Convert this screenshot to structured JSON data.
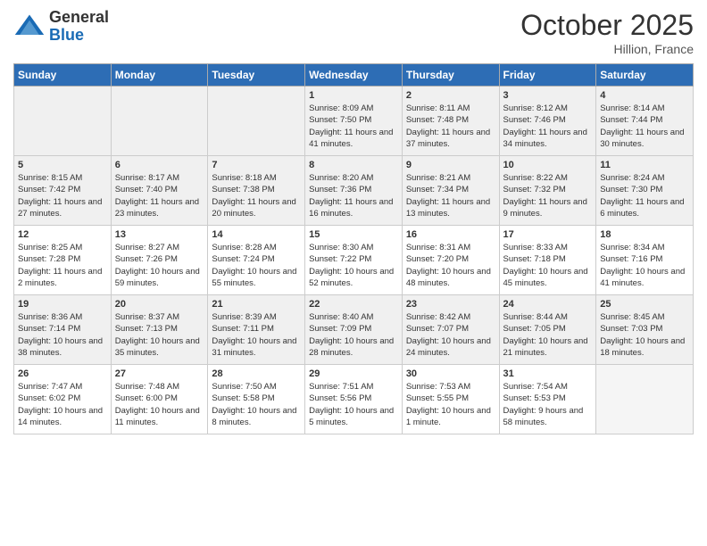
{
  "logo": {
    "general": "General",
    "blue": "Blue"
  },
  "header": {
    "title": "October 2025",
    "location": "Hillion, France"
  },
  "days": [
    "Sunday",
    "Monday",
    "Tuesday",
    "Wednesday",
    "Thursday",
    "Friday",
    "Saturday"
  ],
  "weeks": [
    [
      {
        "day": "",
        "sunrise": "",
        "sunset": "",
        "daylight": "",
        "shaded": true
      },
      {
        "day": "",
        "sunrise": "",
        "sunset": "",
        "daylight": "",
        "shaded": true
      },
      {
        "day": "",
        "sunrise": "",
        "sunset": "",
        "daylight": "",
        "shaded": true
      },
      {
        "day": "1",
        "sunrise": "Sunrise: 8:09 AM",
        "sunset": "Sunset: 7:50 PM",
        "daylight": "Daylight: 11 hours and 41 minutes.",
        "shaded": false
      },
      {
        "day": "2",
        "sunrise": "Sunrise: 8:11 AM",
        "sunset": "Sunset: 7:48 PM",
        "daylight": "Daylight: 11 hours and 37 minutes.",
        "shaded": false
      },
      {
        "day": "3",
        "sunrise": "Sunrise: 8:12 AM",
        "sunset": "Sunset: 7:46 PM",
        "daylight": "Daylight: 11 hours and 34 minutes.",
        "shaded": false
      },
      {
        "day": "4",
        "sunrise": "Sunrise: 8:14 AM",
        "sunset": "Sunset: 7:44 PM",
        "daylight": "Daylight: 11 hours and 30 minutes.",
        "shaded": false
      }
    ],
    [
      {
        "day": "5",
        "sunrise": "Sunrise: 8:15 AM",
        "sunset": "Sunset: 7:42 PM",
        "daylight": "Daylight: 11 hours and 27 minutes.",
        "shaded": true
      },
      {
        "day": "6",
        "sunrise": "Sunrise: 8:17 AM",
        "sunset": "Sunset: 7:40 PM",
        "daylight": "Daylight: 11 hours and 23 minutes.",
        "shaded": true
      },
      {
        "day": "7",
        "sunrise": "Sunrise: 8:18 AM",
        "sunset": "Sunset: 7:38 PM",
        "daylight": "Daylight: 11 hours and 20 minutes.",
        "shaded": true
      },
      {
        "day": "8",
        "sunrise": "Sunrise: 8:20 AM",
        "sunset": "Sunset: 7:36 PM",
        "daylight": "Daylight: 11 hours and 16 minutes.",
        "shaded": true
      },
      {
        "day": "9",
        "sunrise": "Sunrise: 8:21 AM",
        "sunset": "Sunset: 7:34 PM",
        "daylight": "Daylight: 11 hours and 13 minutes.",
        "shaded": true
      },
      {
        "day": "10",
        "sunrise": "Sunrise: 8:22 AM",
        "sunset": "Sunset: 7:32 PM",
        "daylight": "Daylight: 11 hours and 9 minutes.",
        "shaded": true
      },
      {
        "day": "11",
        "sunrise": "Sunrise: 8:24 AM",
        "sunset": "Sunset: 7:30 PM",
        "daylight": "Daylight: 11 hours and 6 minutes.",
        "shaded": true
      }
    ],
    [
      {
        "day": "12",
        "sunrise": "Sunrise: 8:25 AM",
        "sunset": "Sunset: 7:28 PM",
        "daylight": "Daylight: 11 hours and 2 minutes.",
        "shaded": false
      },
      {
        "day": "13",
        "sunrise": "Sunrise: 8:27 AM",
        "sunset": "Sunset: 7:26 PM",
        "daylight": "Daylight: 10 hours and 59 minutes.",
        "shaded": false
      },
      {
        "day": "14",
        "sunrise": "Sunrise: 8:28 AM",
        "sunset": "Sunset: 7:24 PM",
        "daylight": "Daylight: 10 hours and 55 minutes.",
        "shaded": false
      },
      {
        "day": "15",
        "sunrise": "Sunrise: 8:30 AM",
        "sunset": "Sunset: 7:22 PM",
        "daylight": "Daylight: 10 hours and 52 minutes.",
        "shaded": false
      },
      {
        "day": "16",
        "sunrise": "Sunrise: 8:31 AM",
        "sunset": "Sunset: 7:20 PM",
        "daylight": "Daylight: 10 hours and 48 minutes.",
        "shaded": false
      },
      {
        "day": "17",
        "sunrise": "Sunrise: 8:33 AM",
        "sunset": "Sunset: 7:18 PM",
        "daylight": "Daylight: 10 hours and 45 minutes.",
        "shaded": false
      },
      {
        "day": "18",
        "sunrise": "Sunrise: 8:34 AM",
        "sunset": "Sunset: 7:16 PM",
        "daylight": "Daylight: 10 hours and 41 minutes.",
        "shaded": false
      }
    ],
    [
      {
        "day": "19",
        "sunrise": "Sunrise: 8:36 AM",
        "sunset": "Sunset: 7:14 PM",
        "daylight": "Daylight: 10 hours and 38 minutes.",
        "shaded": true
      },
      {
        "day": "20",
        "sunrise": "Sunrise: 8:37 AM",
        "sunset": "Sunset: 7:13 PM",
        "daylight": "Daylight: 10 hours and 35 minutes.",
        "shaded": true
      },
      {
        "day": "21",
        "sunrise": "Sunrise: 8:39 AM",
        "sunset": "Sunset: 7:11 PM",
        "daylight": "Daylight: 10 hours and 31 minutes.",
        "shaded": true
      },
      {
        "day": "22",
        "sunrise": "Sunrise: 8:40 AM",
        "sunset": "Sunset: 7:09 PM",
        "daylight": "Daylight: 10 hours and 28 minutes.",
        "shaded": true
      },
      {
        "day": "23",
        "sunrise": "Sunrise: 8:42 AM",
        "sunset": "Sunset: 7:07 PM",
        "daylight": "Daylight: 10 hours and 24 minutes.",
        "shaded": true
      },
      {
        "day": "24",
        "sunrise": "Sunrise: 8:44 AM",
        "sunset": "Sunset: 7:05 PM",
        "daylight": "Daylight: 10 hours and 21 minutes.",
        "shaded": true
      },
      {
        "day": "25",
        "sunrise": "Sunrise: 8:45 AM",
        "sunset": "Sunset: 7:03 PM",
        "daylight": "Daylight: 10 hours and 18 minutes.",
        "shaded": true
      }
    ],
    [
      {
        "day": "26",
        "sunrise": "Sunrise: 7:47 AM",
        "sunset": "Sunset: 6:02 PM",
        "daylight": "Daylight: 10 hours and 14 minutes.",
        "shaded": false
      },
      {
        "day": "27",
        "sunrise": "Sunrise: 7:48 AM",
        "sunset": "Sunset: 6:00 PM",
        "daylight": "Daylight: 10 hours and 11 minutes.",
        "shaded": false
      },
      {
        "day": "28",
        "sunrise": "Sunrise: 7:50 AM",
        "sunset": "Sunset: 5:58 PM",
        "daylight": "Daylight: 10 hours and 8 minutes.",
        "shaded": false
      },
      {
        "day": "29",
        "sunrise": "Sunrise: 7:51 AM",
        "sunset": "Sunset: 5:56 PM",
        "daylight": "Daylight: 10 hours and 5 minutes.",
        "shaded": false
      },
      {
        "day": "30",
        "sunrise": "Sunrise: 7:53 AM",
        "sunset": "Sunset: 5:55 PM",
        "daylight": "Daylight: 10 hours and 1 minute.",
        "shaded": false
      },
      {
        "day": "31",
        "sunrise": "Sunrise: 7:54 AM",
        "sunset": "Sunset: 5:53 PM",
        "daylight": "Daylight: 9 hours and 58 minutes.",
        "shaded": false
      },
      {
        "day": "",
        "sunrise": "",
        "sunset": "",
        "daylight": "",
        "shaded": true
      }
    ]
  ]
}
